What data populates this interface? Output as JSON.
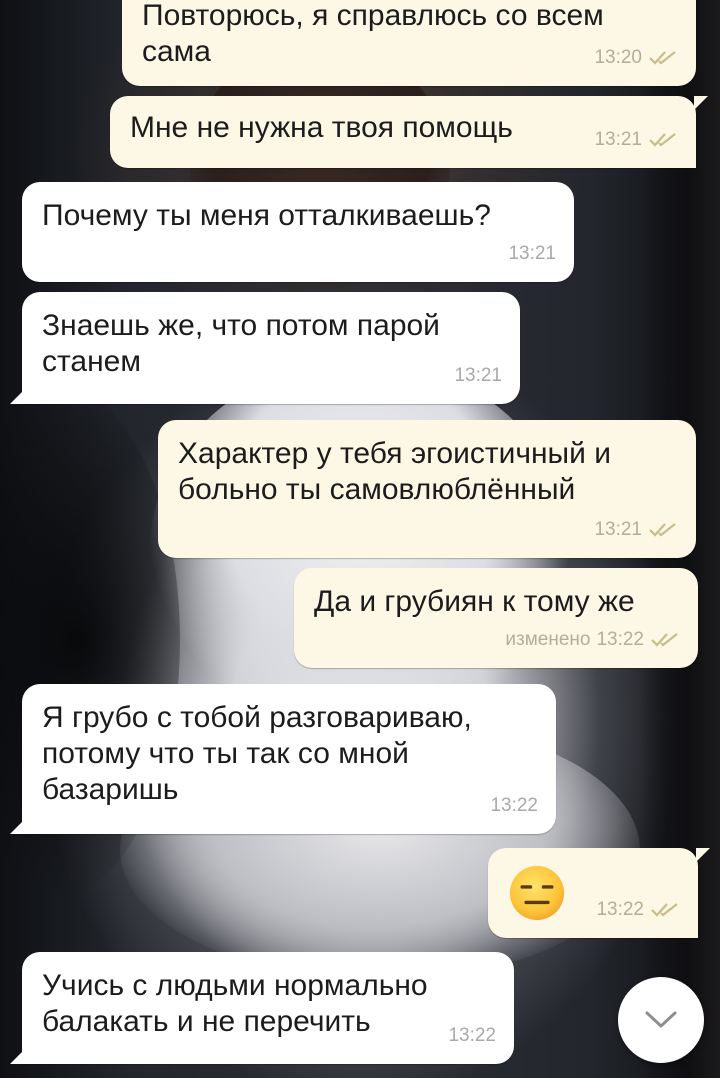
{
  "chat": {
    "messages": [
      {
        "id": "m1",
        "direction": "out",
        "text": "Повторюсь, я справлюсь со всем\nсама",
        "time": "13:20",
        "status": "read"
      },
      {
        "id": "m2",
        "direction": "out",
        "text": "Мне не нужна твоя помощь",
        "time": "13:21",
        "status": "read"
      },
      {
        "id": "m3",
        "direction": "in",
        "text": "Почему ты меня отталкиваешь?",
        "time": "13:21"
      },
      {
        "id": "m4",
        "direction": "in",
        "text": "Знаешь же, что потом парой\nстанем",
        "time": "13:21"
      },
      {
        "id": "m5",
        "direction": "out",
        "text": "Характер у тебя эгоистичный и\nбольно ты самовлюблённый",
        "time": "13:21",
        "status": "read"
      },
      {
        "id": "m6",
        "direction": "out",
        "text": "Да и грубиян к тому же",
        "edited_label": "изменено",
        "time": "13:22",
        "status": "read"
      },
      {
        "id": "m7",
        "direction": "in",
        "text": "Я грубо с тобой разговариваю,\nпотому что ты так со мной\nбазаришь",
        "time": "13:22"
      },
      {
        "id": "m8",
        "direction": "out",
        "emoji": "expressionless-face",
        "time": "13:22",
        "status": "read"
      },
      {
        "id": "m9",
        "direction": "in",
        "text": "Учись с людьми нормально\nбалакать и не перечить",
        "time": "13:22"
      }
    ]
  },
  "colors": {
    "incoming_bubble": "#ffffff",
    "outgoing_bubble": "#fdf7e6",
    "read_check": "#c9bd8a",
    "timestamp": "#a9a9a9"
  },
  "icons": {
    "read_status": "double-check-icon",
    "scroll_down": "chevron-down-icon"
  }
}
